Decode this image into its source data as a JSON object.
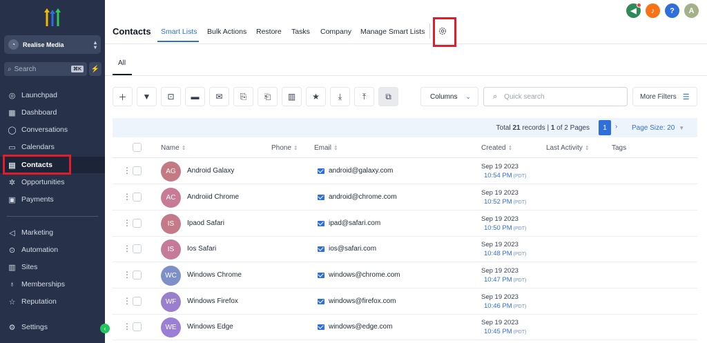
{
  "sidebar": {
    "account_name": "Realise Media",
    "search_placeholder": "Search",
    "search_shortcut": "⌘K",
    "items": [
      {
        "label": "Launchpad",
        "icon": "launchpad-icon"
      },
      {
        "label": "Dashboard",
        "icon": "dashboard-icon"
      },
      {
        "label": "Conversations",
        "icon": "chat-icon"
      },
      {
        "label": "Calendars",
        "icon": "calendar-icon"
      },
      {
        "label": "Contacts",
        "icon": "contacts-icon",
        "active": true
      },
      {
        "label": "Opportunities",
        "icon": "opportunities-icon"
      },
      {
        "label": "Payments",
        "icon": "payments-icon"
      },
      {
        "label": "Marketing",
        "icon": "marketing-icon"
      },
      {
        "label": "Automation",
        "icon": "automation-icon"
      },
      {
        "label": "Sites",
        "icon": "sites-icon"
      },
      {
        "label": "Memberships",
        "icon": "memberships-icon"
      },
      {
        "label": "Reputation",
        "icon": "reputation-icon"
      },
      {
        "label": "Settings",
        "icon": "settings-icon"
      }
    ]
  },
  "header": {
    "title": "Contacts",
    "tabs": [
      "Smart Lists",
      "Bulk Actions",
      "Restore",
      "Tasks",
      "Company",
      "Manage Smart Lists"
    ],
    "user_initial": "A",
    "help_label": "?"
  },
  "subtabs": {
    "all_label": "All"
  },
  "toolbar": {
    "columns_label": "Columns",
    "quick_search_placeholder": "Quick search",
    "more_filters_label": "More Filters"
  },
  "pagination": {
    "total_prefix": "Total ",
    "total_records": "21",
    "records_mid": " records | ",
    "page_current": "1",
    "of_pages": " of 2 Pages",
    "current_page_button": "1",
    "page_size_label": "Page Size: 20"
  },
  "table": {
    "headers": [
      "Name",
      "Phone",
      "Email",
      "Created",
      "Last Activity",
      "Tags"
    ],
    "rows": [
      {
        "initials": "AG",
        "name": "Android Galaxy",
        "email": "android@galaxy.com",
        "date": "Sep 19 2023",
        "time": "10:54 PM",
        "tz": "(PDT)",
        "color": "#c47a80"
      },
      {
        "initials": "AC",
        "name": "Androiid Chrome",
        "email": "android@chrome.com",
        "date": "Sep 19 2023",
        "time": "10:52 PM",
        "tz": "(PDT)",
        "color": "#c97a96"
      },
      {
        "initials": "IS",
        "name": "Ipaod Safari",
        "email": "ipad@safari.com",
        "date": "Sep 19 2023",
        "time": "10:50 PM",
        "tz": "(PDT)",
        "color": "#c47a88"
      },
      {
        "initials": "IS",
        "name": "Ios Safari",
        "email": "ios@safari.com",
        "date": "Sep 19 2023",
        "time": "10:48 PM",
        "tz": "(PDT)",
        "color": "#c47a98"
      },
      {
        "initials": "WC",
        "name": "Windows Chrome",
        "email": "windows@chrome.com",
        "date": "Sep 19 2023",
        "time": "10:47 PM",
        "tz": "(PDT)",
        "color": "#7f8fc8"
      },
      {
        "initials": "WF",
        "name": "Windows Firefox",
        "email": "windows@firefox.com",
        "date": "Sep 19 2023",
        "time": "10:46 PM",
        "tz": "(PDT)",
        "color": "#9b7fcf"
      },
      {
        "initials": "WE",
        "name": "Windows Edge",
        "email": "windows@edge.com",
        "date": "Sep 19 2023",
        "time": "10:45 PM",
        "tz": "(PDT)",
        "color": "#9a7fd4"
      }
    ]
  },
  "colors": {
    "accent": "#2f6fdc",
    "sidebar_bg": "#27324a",
    "highlight": "#e11d2a"
  }
}
